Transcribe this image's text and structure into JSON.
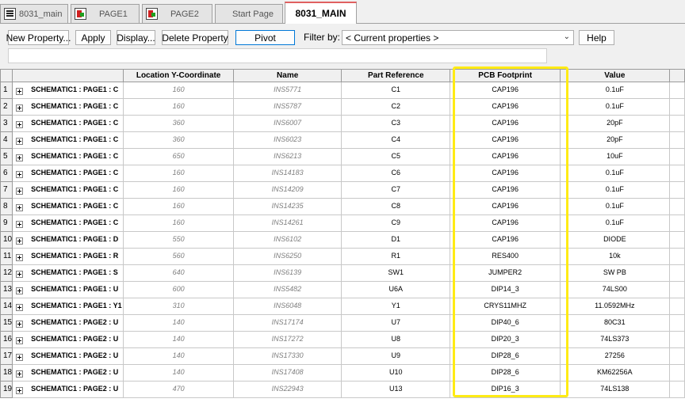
{
  "tabs": [
    {
      "label": "8031_main",
      "icon": "schematic-icon",
      "active": false
    },
    {
      "label": "PAGE1",
      "icon": "page-icon",
      "active": false
    },
    {
      "label": "PAGE2",
      "icon": "page-icon",
      "active": false
    },
    {
      "label": "Start Page",
      "icon": "",
      "active": false
    },
    {
      "label": "8031_MAIN",
      "icon": "",
      "active": true
    }
  ],
  "toolbar": {
    "new_property": "New Property...",
    "apply": "Apply",
    "display": "Display...",
    "delete_property": "Delete Property",
    "pivot": "Pivot",
    "filter_label": "Filter by:",
    "filter_value": "< Current properties >",
    "help": "Help"
  },
  "grid": {
    "columns": [
      "",
      "",
      "Location Y-Coordinate",
      "Name",
      "Part Reference",
      "PCB Footprint",
      "Value"
    ],
    "rows": [
      {
        "num": "1",
        "schematic": "SCHEMATIC1 : PAGE1 : C",
        "y": "160",
        "name": "INS5771",
        "ref": "C1",
        "footprint": "CAP196",
        "value": "0.1uF"
      },
      {
        "num": "2",
        "schematic": "SCHEMATIC1 : PAGE1 : C",
        "y": "160",
        "name": "INS5787",
        "ref": "C2",
        "footprint": "CAP196",
        "value": "0.1uF"
      },
      {
        "num": "3",
        "schematic": "SCHEMATIC1 : PAGE1 : C",
        "y": "360",
        "name": "INS6007",
        "ref": "C3",
        "footprint": "CAP196",
        "value": "20pF"
      },
      {
        "num": "4",
        "schematic": "SCHEMATIC1 : PAGE1 : C",
        "y": "360",
        "name": "INS6023",
        "ref": "C4",
        "footprint": "CAP196",
        "value": "20pF"
      },
      {
        "num": "5",
        "schematic": "SCHEMATIC1 : PAGE1 : C",
        "y": "650",
        "name": "INS6213",
        "ref": "C5",
        "footprint": "CAP196",
        "value": "10uF"
      },
      {
        "num": "6",
        "schematic": "SCHEMATIC1 : PAGE1 : C",
        "y": "160",
        "name": "INS14183",
        "ref": "C6",
        "footprint": "CAP196",
        "value": "0.1uF"
      },
      {
        "num": "7",
        "schematic": "SCHEMATIC1 : PAGE1 : C",
        "y": "160",
        "name": "INS14209",
        "ref": "C7",
        "footprint": "CAP196",
        "value": "0.1uF"
      },
      {
        "num": "8",
        "schematic": "SCHEMATIC1 : PAGE1 : C",
        "y": "160",
        "name": "INS14235",
        "ref": "C8",
        "footprint": "CAP196",
        "value": "0.1uF"
      },
      {
        "num": "9",
        "schematic": "SCHEMATIC1 : PAGE1 : C",
        "y": "160",
        "name": "INS14261",
        "ref": "C9",
        "footprint": "CAP196",
        "value": "0.1uF"
      },
      {
        "num": "10",
        "schematic": "SCHEMATIC1 : PAGE1 : D",
        "y": "550",
        "name": "INS6102",
        "ref": "D1",
        "footprint": "CAP196",
        "value": "DIODE"
      },
      {
        "num": "11",
        "schematic": "SCHEMATIC1 : PAGE1 : R",
        "y": "560",
        "name": "INS6250",
        "ref": "R1",
        "footprint": "RES400",
        "value": "10k"
      },
      {
        "num": "12",
        "schematic": "SCHEMATIC1 : PAGE1 : S",
        "y": "640",
        "name": "INS6139",
        "ref": "SW1",
        "footprint": "JUMPER2",
        "value": "SW PB"
      },
      {
        "num": "13",
        "schematic": "SCHEMATIC1 : PAGE1 : U",
        "y": "600",
        "name": "INS5482",
        "ref": "U6A",
        "footprint": "DIP14_3",
        "value": "74LS00"
      },
      {
        "num": "14",
        "schematic": "SCHEMATIC1 : PAGE1 : Y1",
        "y": "310",
        "name": "INS6048",
        "ref": "Y1",
        "footprint": "CRYS11MHZ",
        "value": "11.0592MHz"
      },
      {
        "num": "15",
        "schematic": "SCHEMATIC1 : PAGE2 : U",
        "y": "140",
        "name": "INS17174",
        "ref": "U7",
        "footprint": "DIP40_6",
        "value": "80C31"
      },
      {
        "num": "16",
        "schematic": "SCHEMATIC1 : PAGE2 : U",
        "y": "140",
        "name": "INS17272",
        "ref": "U8",
        "footprint": "DIP20_3",
        "value": "74LS373"
      },
      {
        "num": "17",
        "schematic": "SCHEMATIC1 : PAGE2 : U",
        "y": "140",
        "name": "INS17330",
        "ref": "U9",
        "footprint": "DIP28_6",
        "value": "27256"
      },
      {
        "num": "18",
        "schematic": "SCHEMATIC1 : PAGE2 : U",
        "y": "140",
        "name": "INS17408",
        "ref": "U10",
        "footprint": "DIP28_6",
        "value": "KM62256A"
      },
      {
        "num": "19",
        "schematic": "SCHEMATIC1 : PAGE2 : U",
        "y": "470",
        "name": "INS22943",
        "ref": "U13",
        "footprint": "DIP16_3",
        "value": "74LS138"
      }
    ]
  },
  "colors": {
    "highlight": "#ffeb14",
    "active_tab_accent": "#e06060",
    "pivot_border": "#0078d7"
  }
}
